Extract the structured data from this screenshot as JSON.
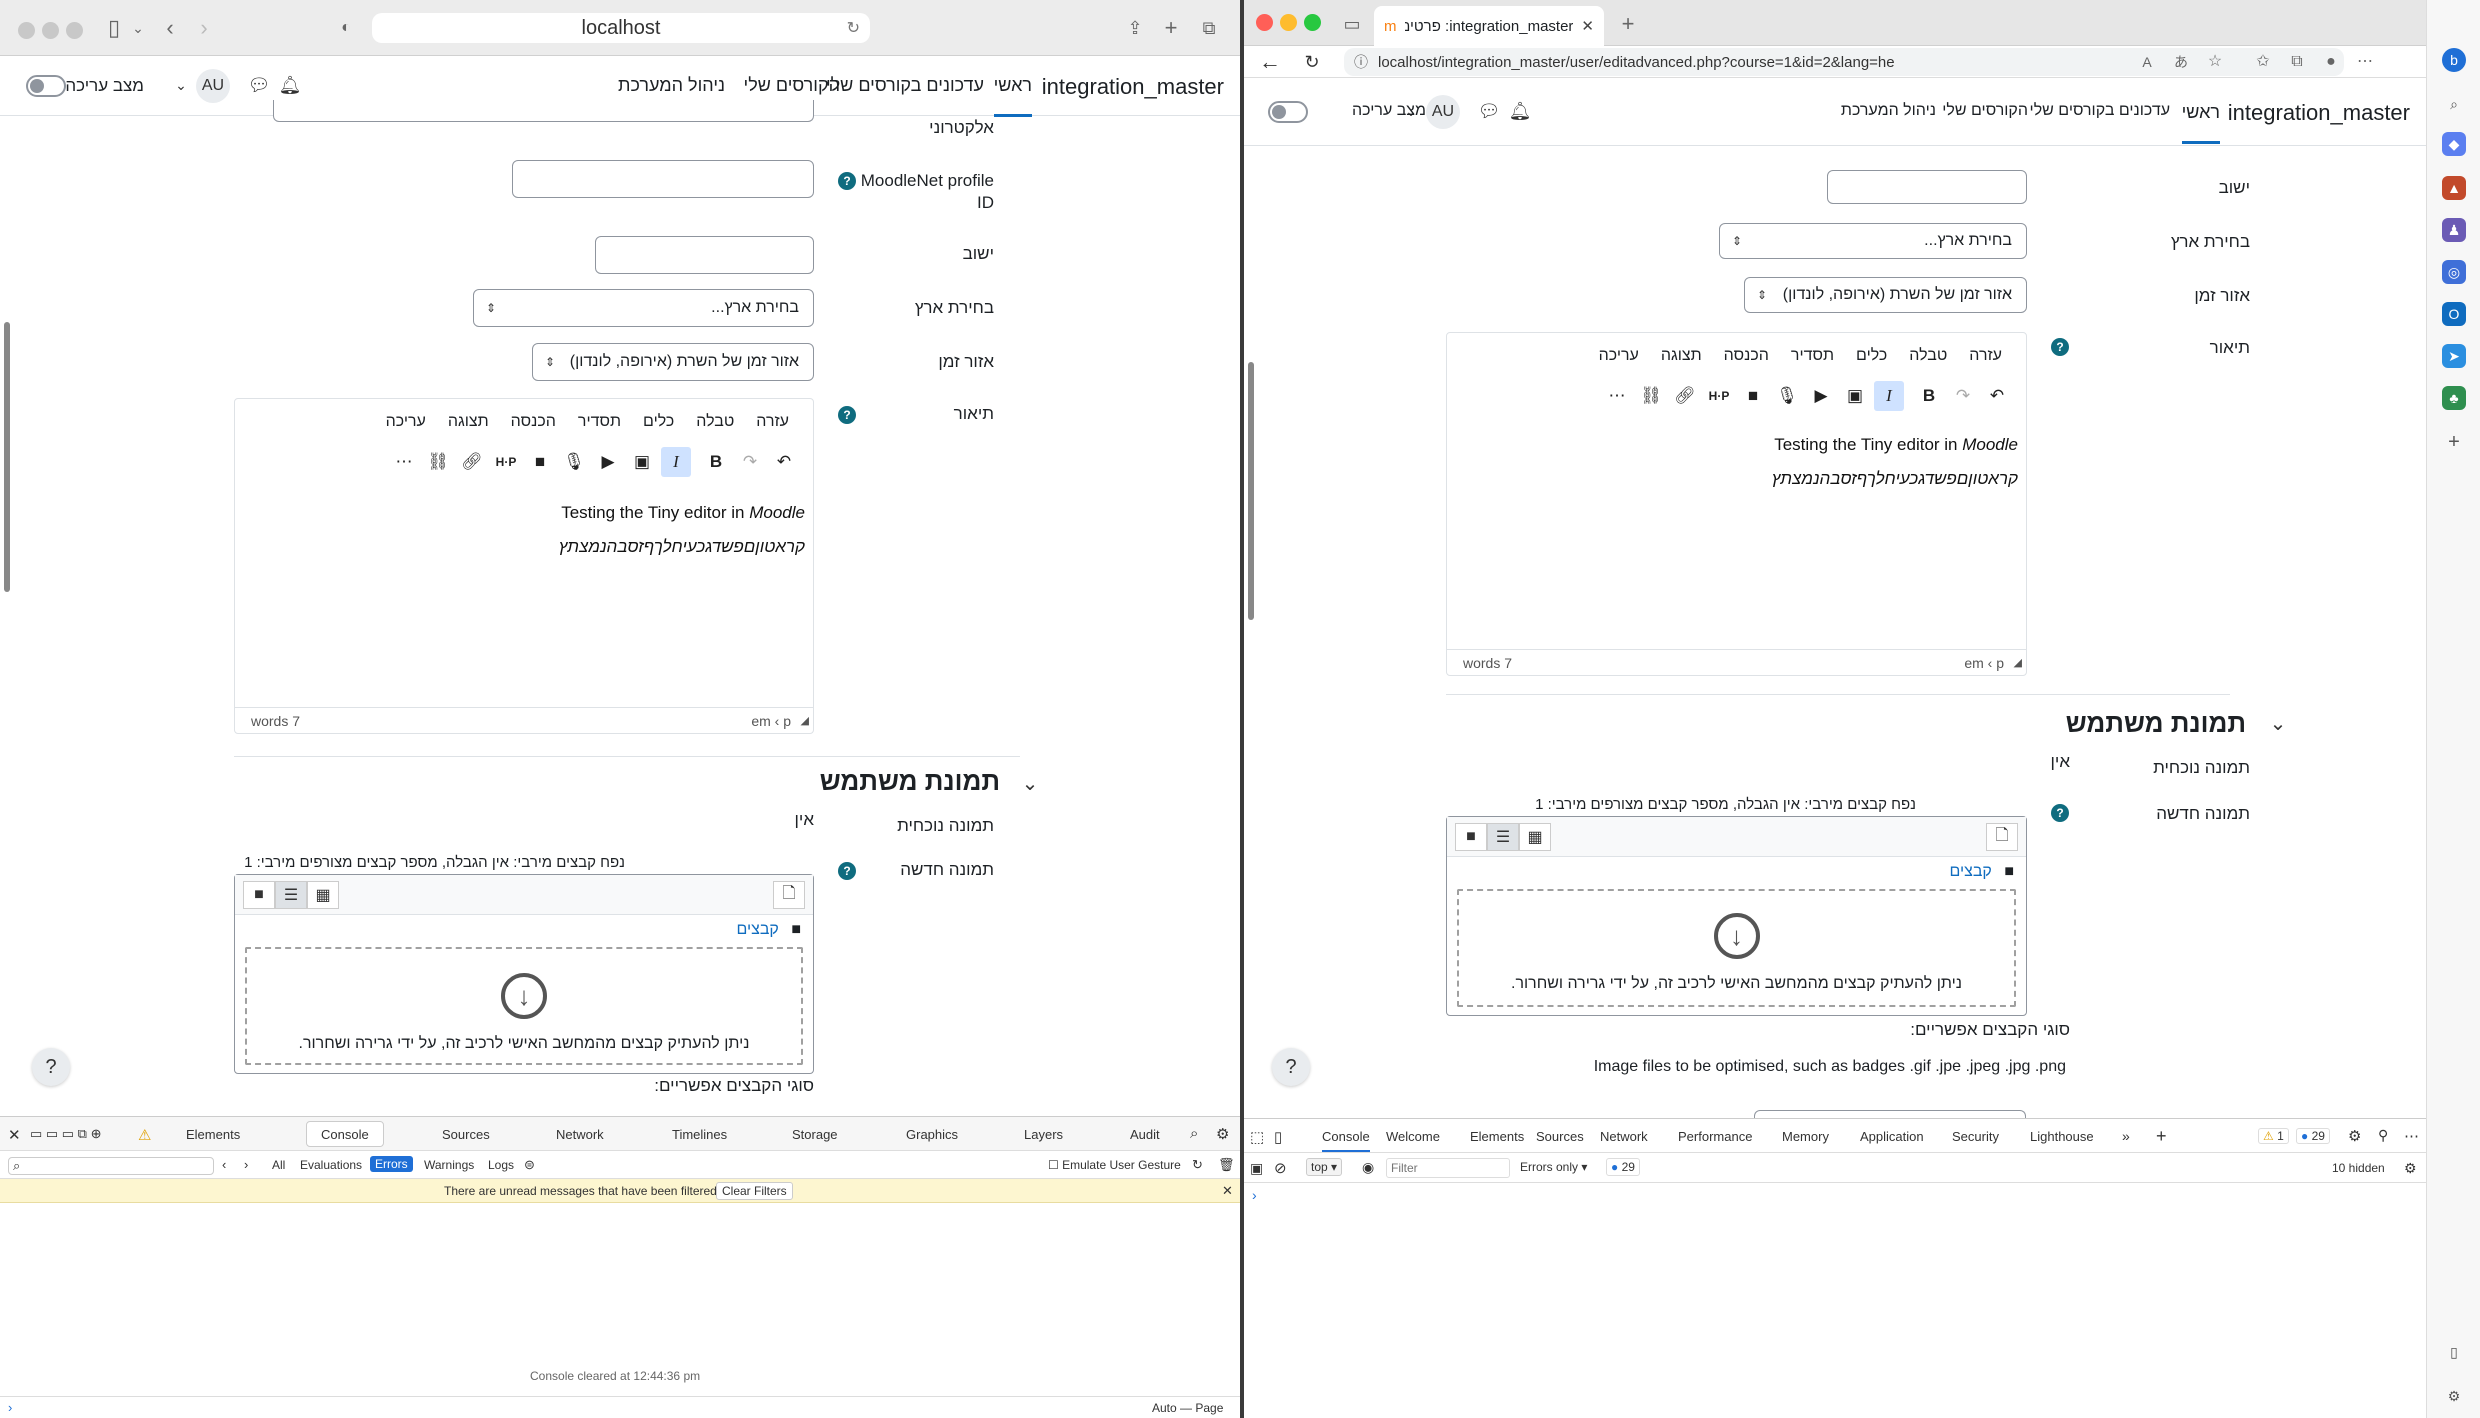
{
  "safari": {
    "url": "localhost",
    "brand": "integration_master",
    "nav": [
      "ראשי",
      "עדכונים בקורסים שלי",
      "הקורסים שלי",
      "ניהול המערכת"
    ],
    "avatar": "AU",
    "edit_mode": "מצב עריכה",
    "fields": {
      "email_label": "אלקטרוני",
      "moodlenet_label": "MoodleNet profile ID",
      "city_label": "ישוב",
      "country_label": "בחירת ארץ",
      "country_value": "בחירת ארץ...",
      "timezone_label": "אזור זמן",
      "timezone_value": "אזור זמן של השרת (אירופה, לונדון)",
      "description_label": "תיאור"
    },
    "editor": {
      "menu": [
        "עריכה",
        "תצוגה",
        "הכנסה",
        "תסדיר",
        "כלים",
        "טבלה",
        "עזרה"
      ],
      "line1_prefix": "Testing the Tiny editor in ",
      "line1_italic": "Moodle",
      "line2": "קראטוןםפשדגכעיחלךףזסבהנמצתץ",
      "words": "words 7",
      "path": "em ‹ p"
    },
    "picture": {
      "heading": "תמונת משתמש",
      "current_label": "תמונה נוכחית",
      "current_value": "אין",
      "new_label": "תמונה חדשה",
      "limits": "נפח קבצים מירבי: אין הגבלה, מספר קבצים מצורפים מירבי: 1",
      "folder": "קבצים",
      "drop_text": "ניתן להעתיק קבצים מהמחשב האישי לרכיב זה, על ידי גרירה ושחרור.",
      "accepted": "סוגי הקבצים אפשריים:"
    },
    "help_button": "?",
    "devtools": {
      "tabs": [
        "Elements",
        "Console",
        "Sources",
        "Network",
        "Timelines",
        "Storage",
        "Graphics",
        "Layers",
        "Audit"
      ],
      "filters": [
        "All",
        "Evaluations",
        "Errors",
        "Warnings",
        "Logs"
      ],
      "emulate": "Emulate User Gesture",
      "banner": "There are unread messages that have been filtered",
      "clear_filters": "Clear Filters",
      "cleared": "Console cleared at 12:44:36 pm",
      "auto_page": "Auto — Page"
    }
  },
  "edge": {
    "tab_title": "integration_master: פרטים אישיים שלי",
    "url": "localhost/integration_master/user/editadvanced.php?course=1&id=2&lang=he",
    "brand": "integration_master",
    "nav": [
      "ראשי",
      "עדכונים בקורסים שלי",
      "הקורסים שלי",
      "ניהול המערכת"
    ],
    "avatar": "AU",
    "edit_mode": "מצב עריכה",
    "fields": {
      "city_label": "ישוב",
      "country_label": "בחירת ארץ",
      "country_value": "בחירת ארץ...",
      "timezone_label": "אזור זמן",
      "timezone_value": "אזור זמן של השרת (אירופה, לונדון)",
      "description_label": "תיאור"
    },
    "editor": {
      "menu": [
        "עריכה",
        "תצוגה",
        "הכנסה",
        "תסדיר",
        "כלים",
        "טבלה",
        "עזרה"
      ],
      "line1_prefix": "Testing the Tiny editor in ",
      "line1_italic": "Moodle",
      "line2": "קראטוןםפשדגכעיחלךףזסבהנמצתץ",
      "words": "words 7",
      "path": "em ‹ p"
    },
    "picture": {
      "heading": "תמונת משתמש",
      "current_label": "תמונה נוכחית",
      "current_value": "אין",
      "new_label": "תמונה חדשה",
      "limits": "נפח קבצים מירבי: אין הגבלה, מספר קבצים מצורפים מירבי: 1",
      "folder": "קבצים",
      "drop_text": "ניתן להעתיק קבצים מהמחשב האישי לרכיב זה, על ידי גרירה ושחרור.",
      "accepted": "סוגי הקבצים אפשריים:",
      "types": "Image files to be optimised, such as badges .gif .jpe .jpeg .jpg .png"
    },
    "help_button": "?",
    "devtools": {
      "tabs": [
        "Console",
        "Welcome",
        "Elements",
        "Sources",
        "Network",
        "Performance",
        "Memory",
        "Application",
        "Security",
        "Lighthouse"
      ],
      "warn_count": "1",
      "info_count": "29",
      "context": "top",
      "filter_placeholder": "Filter",
      "levels": "Errors only",
      "issues": "29",
      "hidden": "10 hidden"
    }
  }
}
